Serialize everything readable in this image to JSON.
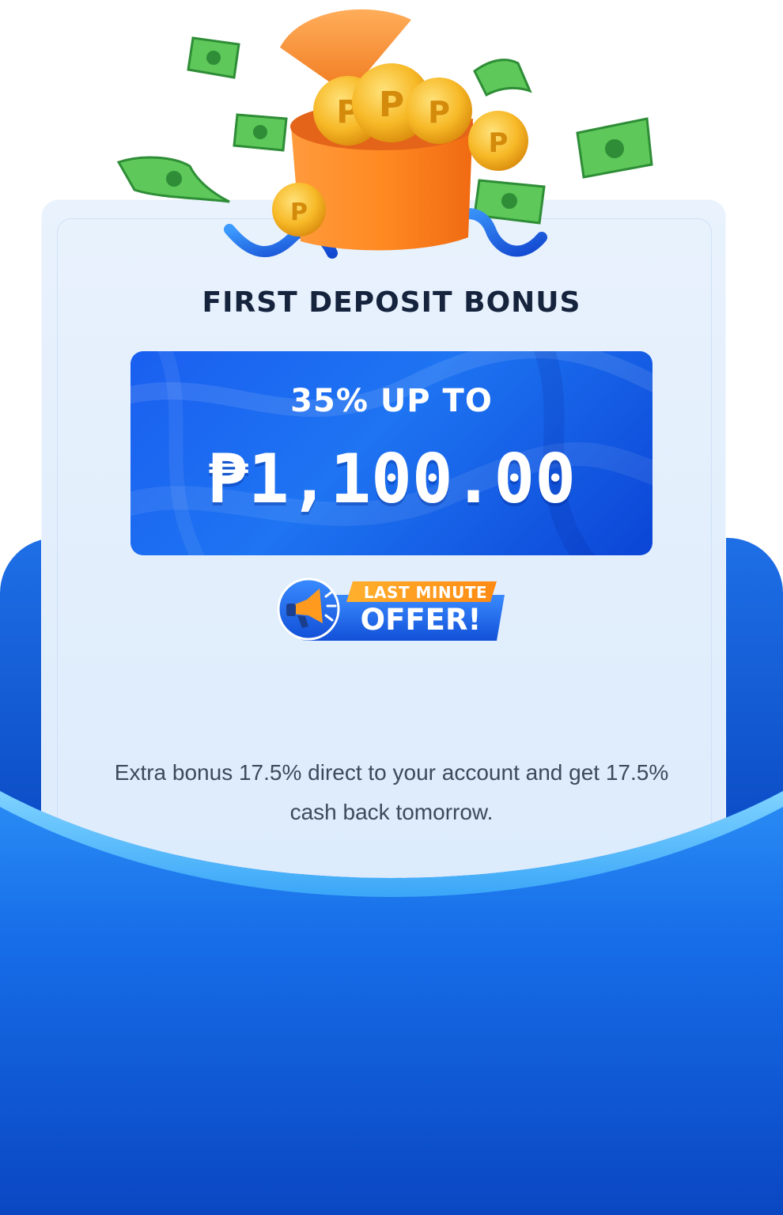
{
  "promo": {
    "title": "FIRST DEPOSIT BONUS",
    "percent_label": "35% UP TO",
    "amount": "₱1,100.00",
    "badge": {
      "top": "LAST MINUTE",
      "bottom": "OFFER!"
    },
    "description": "Extra bonus 17.5% direct to your account and get 17.5% cash back tomorrow."
  },
  "icons": {
    "gift": "gift-box-icon",
    "coin": "peso-coin-icon",
    "banknote": "banknote-icon",
    "megaphone": "megaphone-icon",
    "ribbon": "ribbon-icon"
  },
  "colors": {
    "accent_blue": "#1e6fe6",
    "title_dark": "#16233d",
    "badge_orange": "#ff9a1f"
  }
}
